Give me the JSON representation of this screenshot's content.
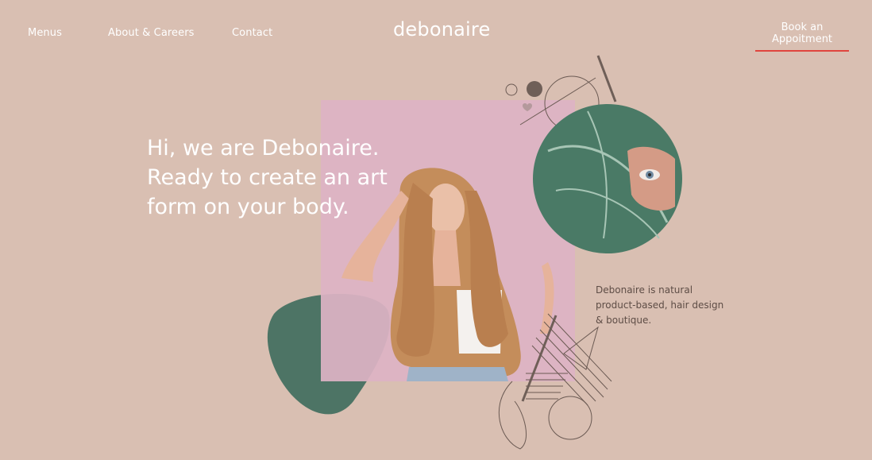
{
  "nav": {
    "menus": "Menus",
    "about": "About & Careers",
    "contact": "Contact"
  },
  "brand": "debonaire",
  "cta": "Book an Appoitment",
  "hero": {
    "line1": "Hi, we are Debonaire.",
    "line2": "Ready to create an art",
    "line3": "form on your body."
  },
  "description": "Debonaire is natural product-based, hair design & boutique.",
  "colors": {
    "background": "#d9bfb2",
    "accent_underline": "#e0453e",
    "pink_panel": "#ddb3c4",
    "green_blob": "#4d7465",
    "text_dark": "#5e4d46"
  }
}
